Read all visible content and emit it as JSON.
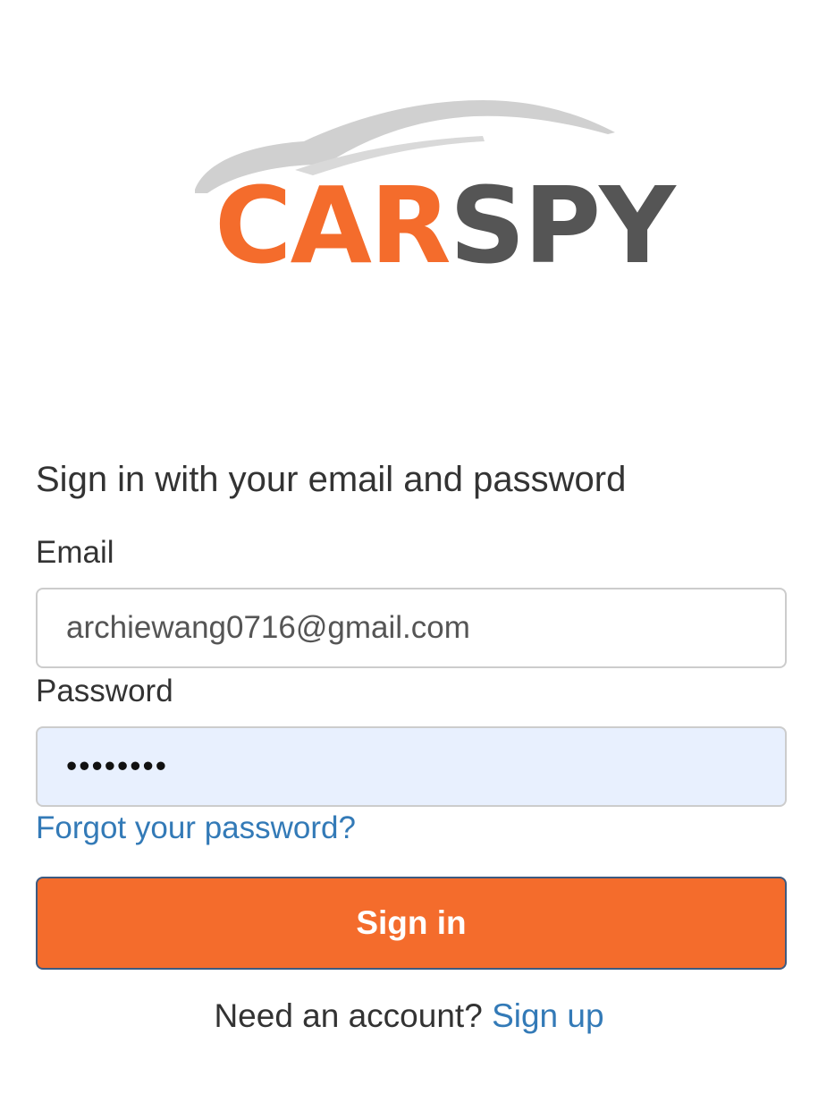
{
  "logo": {
    "text_car": "CAR",
    "text_spy": "SPY",
    "colors": {
      "car": "#f46c2c",
      "spy": "#555555",
      "swoosh": "#cccccc"
    }
  },
  "form": {
    "heading": "Sign in with your email and password",
    "email_label": "Email",
    "email_value": "archiewang0716@gmail.com",
    "password_label": "Password",
    "password_value": "••••••••",
    "forgot_link": "Forgot your password?",
    "signin_button": "Sign in"
  },
  "footer": {
    "prompt": "Need an account?",
    "signup_link": "Sign up"
  },
  "colors": {
    "accent": "#f46c2c",
    "link": "#337ab7",
    "autofill_bg": "#e8f0fe"
  }
}
